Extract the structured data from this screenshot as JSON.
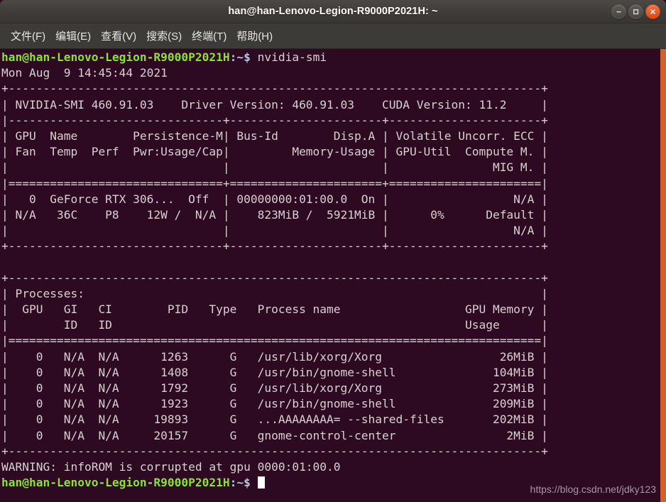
{
  "window": {
    "title": "han@han-Lenovo-Legion-R9000P2021H: ~",
    "controls": {
      "minimize_label": "−",
      "maximize_label": "□",
      "close_label": "×"
    },
    "colors": {
      "titlebar": "#403d3a",
      "menubar": "#3c3b37",
      "terminal_bg": "#2d0922",
      "terminal_fg": "#d8d2d0",
      "prompt_green": "#8ae234",
      "prompt_blue": "#b8c6e0",
      "close_button": "#dd4814",
      "scroll_strip": "#d4602c"
    }
  },
  "menu": {
    "items": [
      {
        "label": "文件(F)"
      },
      {
        "label": "编辑(E)"
      },
      {
        "label": "查看(V)"
      },
      {
        "label": "搜索(S)"
      },
      {
        "label": "终端(T)"
      },
      {
        "label": "帮助(H)"
      }
    ]
  },
  "terminal": {
    "prompt": {
      "user_host": "han@han-Lenovo-Legion-R9000P2021H",
      "separator": ":",
      "path": "~",
      "sigil": "$"
    },
    "command": "nvidia-smi",
    "timestamp": "Mon Aug  9 14:45:44 2021",
    "lines": [
      "+-----------------------------------------------------------------------------+",
      "| NVIDIA-SMI 460.91.03    Driver Version: 460.91.03    CUDA Version: 11.2     |",
      "|-------------------------------+----------------------+----------------------+",
      "| GPU  Name        Persistence-M| Bus-Id        Disp.A | Volatile Uncorr. ECC |",
      "| Fan  Temp  Perf  Pwr:Usage/Cap|         Memory-Usage | GPU-Util  Compute M. |",
      "|                               |                      |               MIG M. |",
      "|===============================+======================+======================|",
      "|   0  GeForce RTX 306...  Off  | 00000000:01:00.0  On |                  N/A |",
      "| N/A   36C    P8    12W /  N/A |    823MiB /  5921MiB |      0%      Default |",
      "|                               |                      |                  N/A |",
      "+-------------------------------+----------------------+----------------------+",
      "",
      "+-----------------------------------------------------------------------------+",
      "| Processes:                                                                  |",
      "|  GPU   GI   CI        PID   Type   Process name                  GPU Memory |",
      "|        ID   ID                                                   Usage      |",
      "|=============================================================================|",
      "|    0   N/A  N/A      1263      G   /usr/lib/xorg/Xorg                 26MiB |",
      "|    0   N/A  N/A      1408      G   /usr/bin/gnome-shell              104MiB |",
      "|    0   N/A  N/A      1792      G   /usr/lib/xorg/Xorg                273MiB |",
      "|    0   N/A  N/A      1923      G   /usr/bin/gnome-shell              209MiB |",
      "|    0   N/A  N/A     19893      G   ...AAAAAAAA= --shared-files       202MiB |",
      "|    0   N/A  N/A     20157      G   gnome-control-center                2MiB |",
      "+-----------------------------------------------------------------------------+"
    ],
    "warning": "WARNING: infoROM is corrupted at gpu 0000:01:00.0",
    "smi_version": "460.91.03",
    "driver_version": "460.91.03",
    "cuda_version": "11.2",
    "gpu": {
      "index": "0",
      "name": "GeForce RTX 306...",
      "persistence_mode": "Off",
      "bus_id": "00000000:01:00.0",
      "display_active": "On",
      "ecc": "N/A",
      "fan": "N/A",
      "temp": "36C",
      "perf": "P8",
      "power_usage": "12W",
      "power_cap": "N/A",
      "memory_used": "823MiB",
      "memory_total": "5921MiB",
      "gpu_util": "0%",
      "compute_mode": "Default",
      "mig_mode": "N/A"
    },
    "processes_headers": [
      "GPU",
      "GI ID",
      "CI ID",
      "PID",
      "Type",
      "Process name",
      "GPU Memory Usage"
    ],
    "processes": [
      {
        "gpu": "0",
        "gi": "N/A",
        "ci": "N/A",
        "pid": "1263",
        "type": "G",
        "name": "/usr/lib/xorg/Xorg",
        "memory": "26MiB"
      },
      {
        "gpu": "0",
        "gi": "N/A",
        "ci": "N/A",
        "pid": "1408",
        "type": "G",
        "name": "/usr/bin/gnome-shell",
        "memory": "104MiB"
      },
      {
        "gpu": "0",
        "gi": "N/A",
        "ci": "N/A",
        "pid": "1792",
        "type": "G",
        "name": "/usr/lib/xorg/Xorg",
        "memory": "273MiB"
      },
      {
        "gpu": "0",
        "gi": "N/A",
        "ci": "N/A",
        "pid": "1923",
        "type": "G",
        "name": "/usr/bin/gnome-shell",
        "memory": "209MiB"
      },
      {
        "gpu": "0",
        "gi": "N/A",
        "ci": "N/A",
        "pid": "19893",
        "type": "G",
        "name": "...AAAAAAAA= --shared-files",
        "memory": "202MiB"
      },
      {
        "gpu": "0",
        "gi": "N/A",
        "ci": "N/A",
        "pid": "20157",
        "type": "G",
        "name": "gnome-control-center",
        "memory": "2MiB"
      }
    ]
  },
  "watermark": "https://blog.csdn.net/jdky123"
}
